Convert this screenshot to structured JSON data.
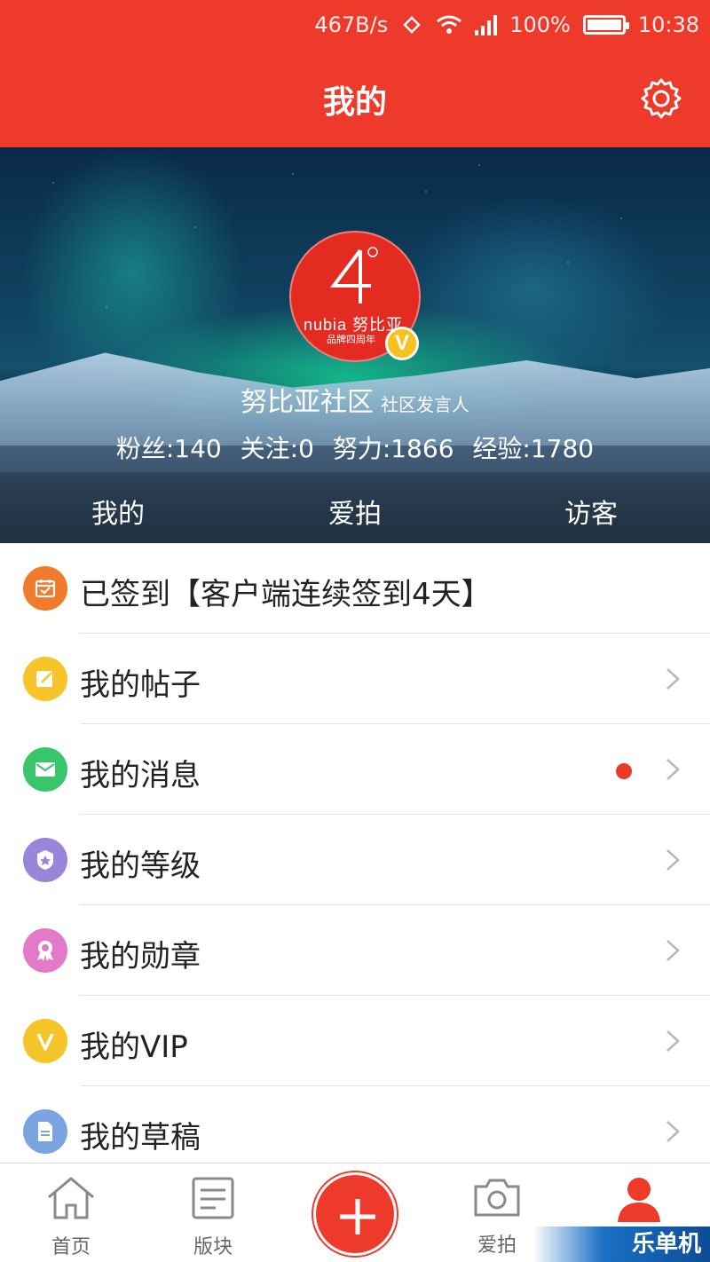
{
  "status_bar": {
    "speed": "467B/s",
    "battery": "100%",
    "time": "10:38"
  },
  "header": {
    "title": "我的",
    "settings_icon": "gear-icon"
  },
  "profile": {
    "avatar_brand": "nubia 努比亚",
    "avatar_sub": "品牌四周年",
    "badge": "V",
    "name": "努比亚社区",
    "role": "社区发言人",
    "stats": {
      "fans": "粉丝:140",
      "following": "关注:0",
      "effort": "努力:1866",
      "experience": "经验:1780"
    }
  },
  "profile_tabs": [
    {
      "label": "我的",
      "active": true
    },
    {
      "label": "爱拍",
      "active": false
    },
    {
      "label": "访客",
      "active": false
    }
  ],
  "menu": [
    {
      "label": "已签到【客户端连续签到4天】",
      "icon": "calendar-check-icon",
      "color": "#f27a2c",
      "chevron": false,
      "dot": false
    },
    {
      "label": "我的帖子",
      "icon": "edit-note-icon",
      "color": "#f7c52a",
      "chevron": true,
      "dot": false
    },
    {
      "label": "我的消息",
      "icon": "mail-icon",
      "color": "#39c66b",
      "chevron": true,
      "dot": true
    },
    {
      "label": "我的等级",
      "icon": "level-badge-icon",
      "color": "#9a86d8",
      "chevron": true,
      "dot": false
    },
    {
      "label": "我的勋章",
      "icon": "medal-icon",
      "color": "#e27ac8",
      "chevron": true,
      "dot": false
    },
    {
      "label": "我的VIP",
      "icon": "vip-icon",
      "color": "#f5c32a",
      "chevron": true,
      "dot": false
    },
    {
      "label": "我的草稿",
      "icon": "draft-icon",
      "color": "#7aa5e0",
      "chevron": true,
      "dot": false
    }
  ],
  "bottom_nav": {
    "home": "首页",
    "boards": "版块",
    "photo": "爱拍",
    "watermark": "乐单机"
  },
  "colors": {
    "brand_red": "#ee3a2a",
    "notification_dot": "#e8392a"
  }
}
